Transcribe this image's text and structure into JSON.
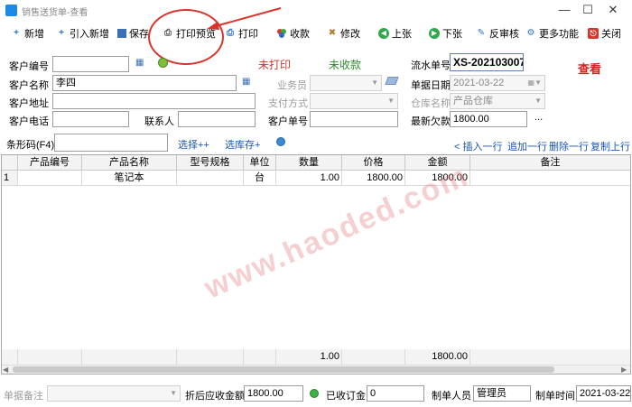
{
  "window": {
    "title": "销售送货单-查看"
  },
  "toolbar": {
    "new": "新增",
    "import_new": "引入新增",
    "save": "保存",
    "print_preview": "打印预览",
    "print": "打印",
    "collect": "收款",
    "modify": "修改",
    "prev": "上张",
    "next": "下张",
    "unaudit": "反审核",
    "more": "更多功能",
    "close": "关闭"
  },
  "form": {
    "customer_no_label": "客户编号",
    "customer_no": "",
    "customer_name_label": "客户名称",
    "customer_name": "李四",
    "customer_addr_label": "客户地址",
    "customer_addr": "",
    "customer_phone_label": "客户电话",
    "customer_phone": "",
    "contact_label": "联系人",
    "contact": "",
    "print_status": "未打印",
    "pay_status": "未收款",
    "salesperson_label": "业务员",
    "salesperson": "",
    "pay_method_label": "支付方式",
    "pay_method": "",
    "customer_order_label": "客户单号",
    "customer_order": "",
    "serial_label": "流水单号",
    "serial": "XS-202103007",
    "date_label": "单据日期",
    "date": "2021-03-22",
    "warehouse_label": "仓库名称",
    "warehouse": "产品仓库",
    "latest_debt_label": "最新欠款",
    "latest_debt": "1800.00",
    "more_dots": "...",
    "view_mark": "查看"
  },
  "barcode": {
    "label": "条形码(F4)",
    "value": "",
    "select_plus": "选择++",
    "select_stock": "选库存+"
  },
  "row_actions": {
    "insert": "< 插入一行",
    "append": "追加一行",
    "delete": "删除一行",
    "copy": "复制上行"
  },
  "grid": {
    "columns": [
      "产品编号",
      "产品名称",
      "型号规格",
      "单位",
      "数量",
      "价格",
      "金额",
      "备注"
    ],
    "rows": [
      {
        "index": "1",
        "code": "",
        "name": "笔记本",
        "spec": "",
        "unit": "台",
        "qty": "1.00",
        "price": "1800.00",
        "amount": "1800.00",
        "note": ""
      }
    ],
    "footer": {
      "qty_total": "1.00",
      "amount_total": "1800.00"
    }
  },
  "watermark": "www.haoded.com",
  "bottom": {
    "remark_label": "单据备注",
    "remark": "",
    "receivable_label": "折后应收金额",
    "receivable": "1800.00",
    "deposit_label": "已收订金",
    "deposit": "0",
    "maker_label": "制单人员",
    "maker": "管理员",
    "make_time_label": "制单时间",
    "make_time": "2021-03-22"
  },
  "colors": {
    "accent_red": "#d9342b",
    "status_red": "#c0392b",
    "status_green": "#2e8b2e",
    "link_blue": "#1a56b0"
  }
}
